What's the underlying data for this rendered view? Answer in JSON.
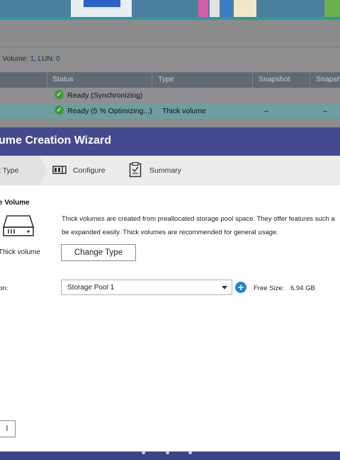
{
  "background": {
    "breadcrumb": {
      "volume_label": ", Volume: ",
      "volume_num": "1",
      "lun_label": ", LUN: ",
      "lun_num": "0"
    },
    "table": {
      "headers": {
        "status": "Status",
        "type": "Type",
        "snapshot": "Snapshot",
        "snapshot2": "Snapsh"
      },
      "rows": [
        {
          "status": "Ready (Synchronizing)",
          "type": "",
          "snapshot": "",
          "snapshot2": ""
        },
        {
          "status": "Ready (5 % Optimizing...)",
          "type": "Thick volume",
          "snapshot": "–",
          "snapshot2": "–"
        }
      ]
    }
  },
  "wizard": {
    "title": "ume Creation Wizard",
    "steps": [
      {
        "label": "t Type",
        "icon": "volume-type-icon"
      },
      {
        "label": "Configure",
        "icon": "configure-icon"
      },
      {
        "label": "Summary",
        "icon": "summary-icon"
      }
    ],
    "section_title": "e Volume",
    "description": [
      "Thick volumes are created from preallocated storage pool space. They offer features such a",
      "be expanded easily. Thick volumes are recommended for general usage."
    ],
    "volume_type_label": "Thick volume",
    "change_type_button": "Change Type",
    "location_label": "on:",
    "storage_pool_selected": "Storage Pool 1",
    "free_size_label": "Free Size:",
    "free_size_value": "6.94 GB",
    "left_button_label": "l"
  },
  "colors": {
    "title_bar": "#434b8e",
    "accent_plus": "#1d8ad0",
    "ready_check": "#3c9a3c"
  }
}
